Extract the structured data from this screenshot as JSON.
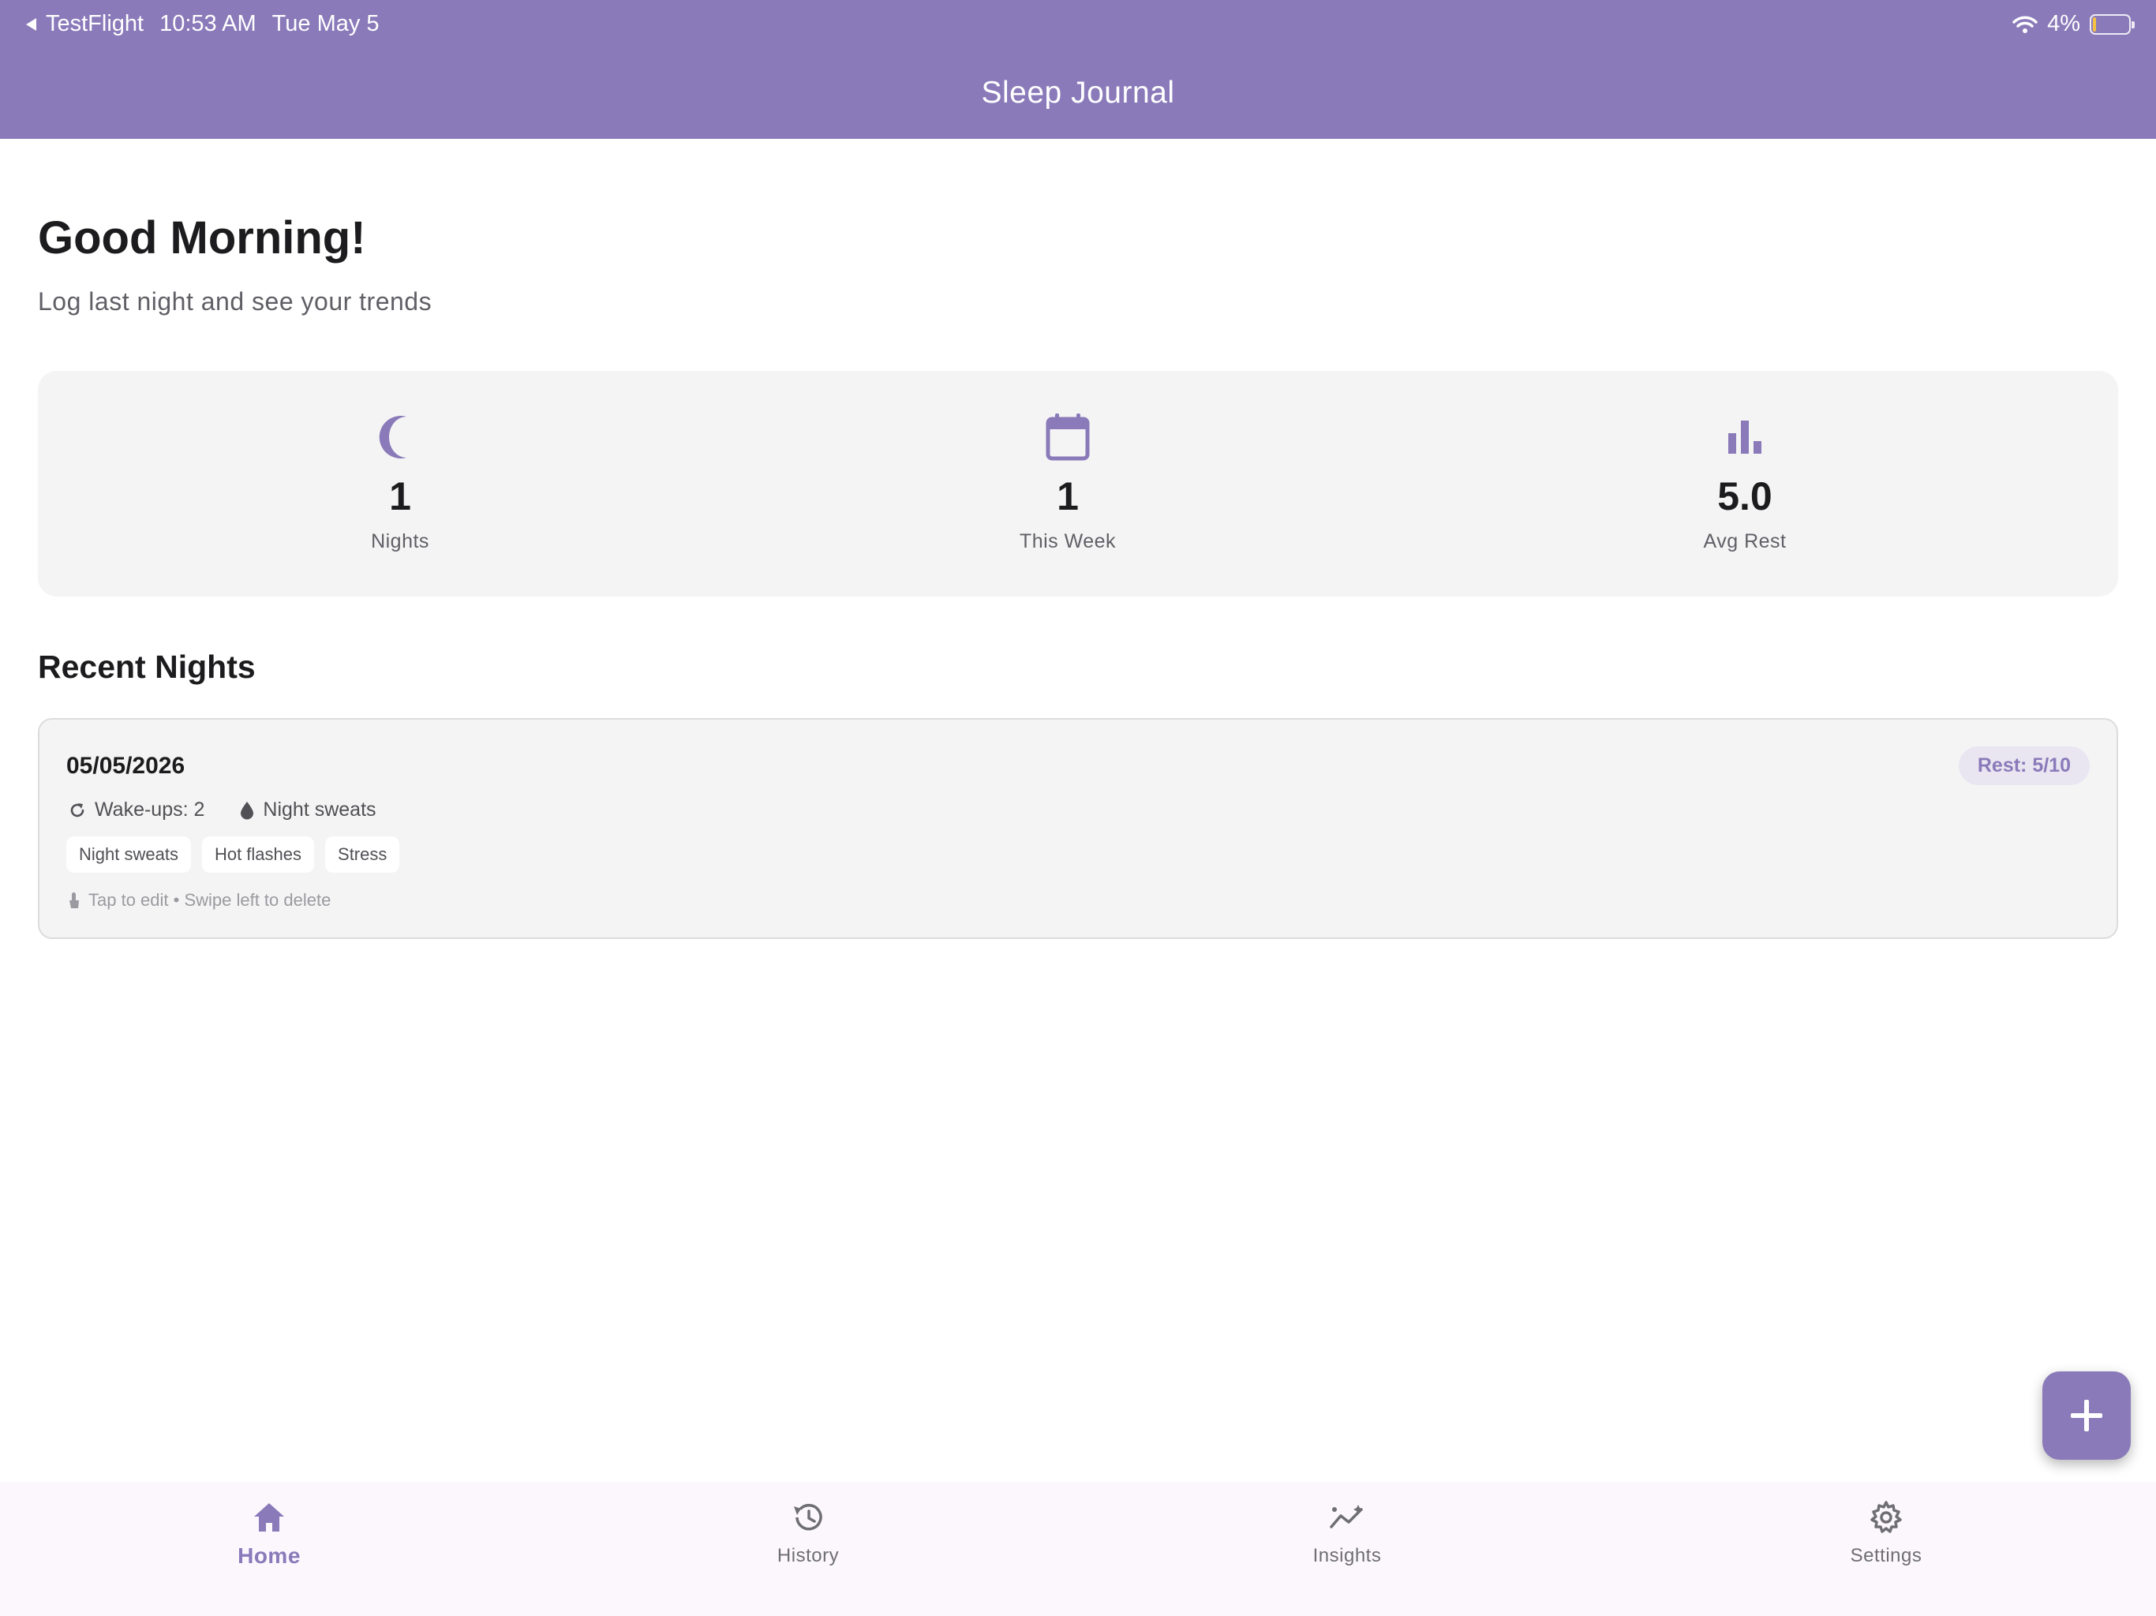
{
  "status_bar": {
    "back_app": "TestFlight",
    "time": "10:53 AM",
    "date": "Tue May 5",
    "battery": "4%"
  },
  "header": {
    "title": "Sleep Journal"
  },
  "greeting": {
    "title": "Good Morning!",
    "subtitle": "Log last night and see your trends"
  },
  "stats": [
    {
      "icon": "moon-icon",
      "value": "1",
      "label": "Nights"
    },
    {
      "icon": "calendar-icon",
      "value": "1",
      "label": "This Week"
    },
    {
      "icon": "bar-chart-icon",
      "value": "5.0",
      "label": "Avg Rest"
    }
  ],
  "recent": {
    "title": "Recent Nights",
    "entries": [
      {
        "date": "05/05/2026",
        "rest": "Rest: 5/10",
        "wakeups": "Wake-ups: 2",
        "sweats": "Night sweats",
        "tags": [
          "Night sweats",
          "Hot flashes",
          "Stress"
        ],
        "hint": "Tap to edit • Swipe left to delete"
      }
    ]
  },
  "fab": {
    "icon": "plus-icon"
  },
  "tabs": [
    {
      "label": "Home",
      "icon": "home-icon",
      "active": true
    },
    {
      "label": "History",
      "icon": "history-icon",
      "active": false
    },
    {
      "label": "Insights",
      "icon": "insights-icon",
      "active": false
    },
    {
      "label": "Settings",
      "icon": "gear-icon",
      "active": false
    }
  ],
  "colors": {
    "accent": "#8a7ab9",
    "card": "#f4f4f4",
    "tab_bar": "#fbf7fd",
    "battery_low": "#f5c242"
  }
}
